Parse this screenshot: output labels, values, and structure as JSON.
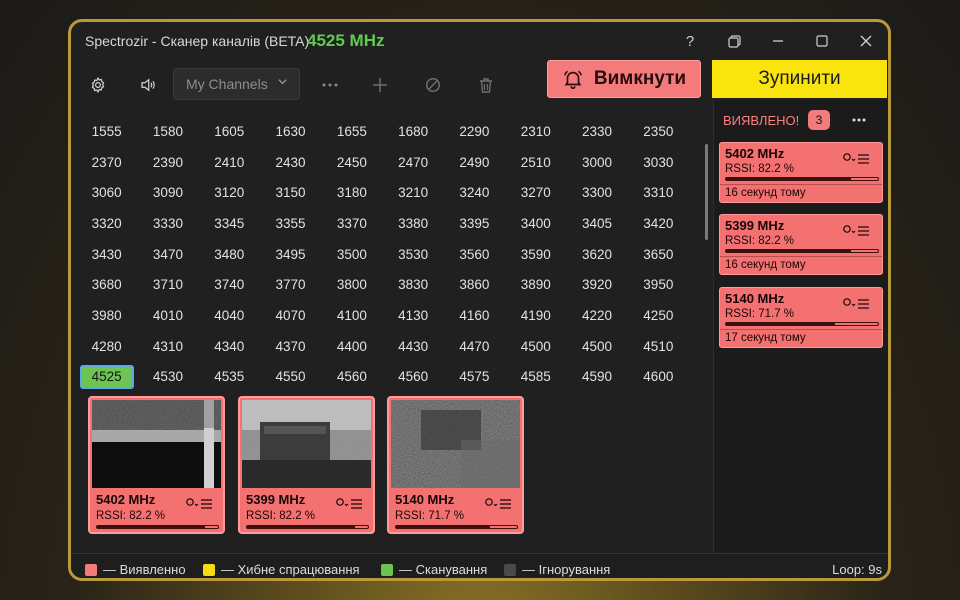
{
  "window": {
    "title": "Spectrozir - Сканер каналів (BETA)",
    "current_freq": "4525 MHz",
    "help_icon": "help-icon",
    "controls": [
      "restore-icon",
      "minimize-icon",
      "maximize-icon",
      "close-icon"
    ]
  },
  "toolbar": {
    "channel_list": "My Channels",
    "alarm_label": "Вимкнути",
    "stop_label": "Зупинити"
  },
  "channels": [
    [
      "1555",
      "1580",
      "1605",
      "1630",
      "1655",
      "1680",
      "2290",
      "2310",
      "2330",
      "2350"
    ],
    [
      "2370",
      "2390",
      "2410",
      "2430",
      "2450",
      "2470",
      "2490",
      "2510",
      "3000",
      "3030"
    ],
    [
      "3060",
      "3090",
      "3120",
      "3150",
      "3180",
      "3210",
      "3240",
      "3270",
      "3300",
      "3310"
    ],
    [
      "3320",
      "3330",
      "3345",
      "3355",
      "3370",
      "3380",
      "3395",
      "3400",
      "3405",
      "3420"
    ],
    [
      "3430",
      "3470",
      "3480",
      "3495",
      "3500",
      "3530",
      "3560",
      "3590",
      "3620",
      "3650"
    ],
    [
      "3680",
      "3710",
      "3740",
      "3770",
      "3800",
      "3830",
      "3860",
      "3890",
      "3920",
      "3950"
    ],
    [
      "3980",
      "4010",
      "4040",
      "4070",
      "4100",
      "4130",
      "4160",
      "4190",
      "4220",
      "4250"
    ],
    [
      "4280",
      "4310",
      "4340",
      "4370",
      "4400",
      "4430",
      "4470",
      "4500",
      "4500",
      "4510"
    ],
    [
      "4525",
      "4530",
      "4535",
      "4550",
      "4560",
      "4560",
      "4575",
      "4585",
      "4590",
      "4600"
    ]
  ],
  "active_channel": "4525",
  "thumbnails": [
    {
      "freq": "5402 MHz",
      "rssi": "RSSI: 82.2 %",
      "level": 0.89
    },
    {
      "freq": "5399 MHz",
      "rssi": "RSSI: 82.2 %",
      "level": 0.89
    },
    {
      "freq": "5140 MHz",
      "rssi": "RSSI: 71.7 %",
      "level": 0.78
    }
  ],
  "detections": {
    "header": "ВИЯВЛЕНО!",
    "count": "3",
    "items": [
      {
        "freq": "5402 MHz",
        "rssi": "RSSI: 82.2 %",
        "time": "16 секунд тому",
        "level": 0.82
      },
      {
        "freq": "5399 MHz",
        "rssi": "RSSI: 82.2 %",
        "time": "16 секунд тому",
        "level": 0.82
      },
      {
        "freq": "5140 MHz",
        "rssi": "RSSI: 71.7 %",
        "time": "17 секунд тому",
        "level": 0.72
      }
    ]
  },
  "legend": [
    {
      "label": "— Виявленно",
      "color": "#f47b7b"
    },
    {
      "label": "— Хибне спрацювання",
      "color": "#f5dc11"
    },
    {
      "label": "— Сканування",
      "color": "#6cc552"
    },
    {
      "label": "— Ігнорування",
      "color": "#4a4a4a"
    }
  ],
  "status": {
    "loop": "Loop: 9s"
  }
}
